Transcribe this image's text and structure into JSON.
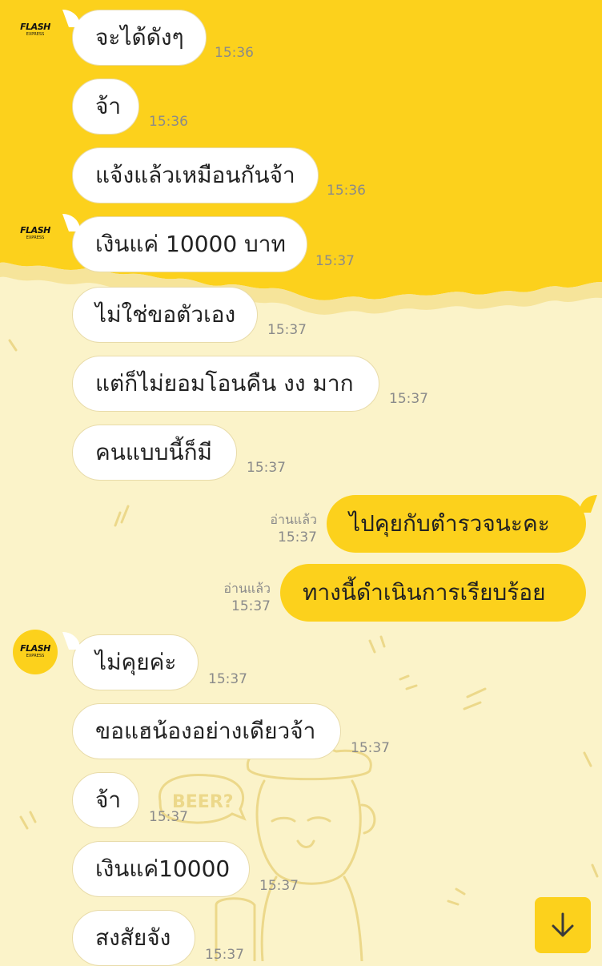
{
  "contact": {
    "avatar_brand": "FLASH",
    "avatar_sub": "EXPRESS"
  },
  "messages": [
    {
      "text": "จะได้ดังๆ",
      "time": "15:36"
    },
    {
      "text": "จ้า",
      "time": "15:36"
    },
    {
      "text": "แจ้งแล้วเหมือนกันจ้า",
      "time": "15:36"
    },
    {
      "text": "เงินแค่ 10000 บาท",
      "time": "15:37"
    },
    {
      "text": "ไม่ใช่ขอตัวเอง",
      "time": "15:37"
    },
    {
      "text": "แต่ก็ไม่ยอมโอนคืน งง มาก",
      "time": "15:37"
    },
    {
      "text": "คนแบบนี้ก็มี",
      "time": "15:37"
    },
    {
      "text": "ไปคุยกับตำรวจนะคะ",
      "time": "15:37",
      "read": "อ่านแล้ว"
    },
    {
      "text": "ทางนี้ดำเนินการเรียบร้อย",
      "time": "15:37",
      "read": "อ่านแล้ว"
    },
    {
      "text": "ไม่คุยค่ะ",
      "time": "15:37"
    },
    {
      "text": "ขอแฮน้องอย่างเดียวจ้า",
      "time": "15:37"
    },
    {
      "text": "จ้า",
      "time": "15:37"
    },
    {
      "text": "เงินแค่10000",
      "time": "15:37"
    },
    {
      "text": "สงสัยจัง",
      "time": "15:37"
    }
  ],
  "background": {
    "doodle_text": "BEER?"
  },
  "colors": {
    "header_yellow": "#fcd11c",
    "background": "#fbf3c9",
    "outgoing": "#fcd11c",
    "incoming": "#ffffff"
  },
  "icons": {
    "scroll_down": "arrow-down-icon"
  }
}
